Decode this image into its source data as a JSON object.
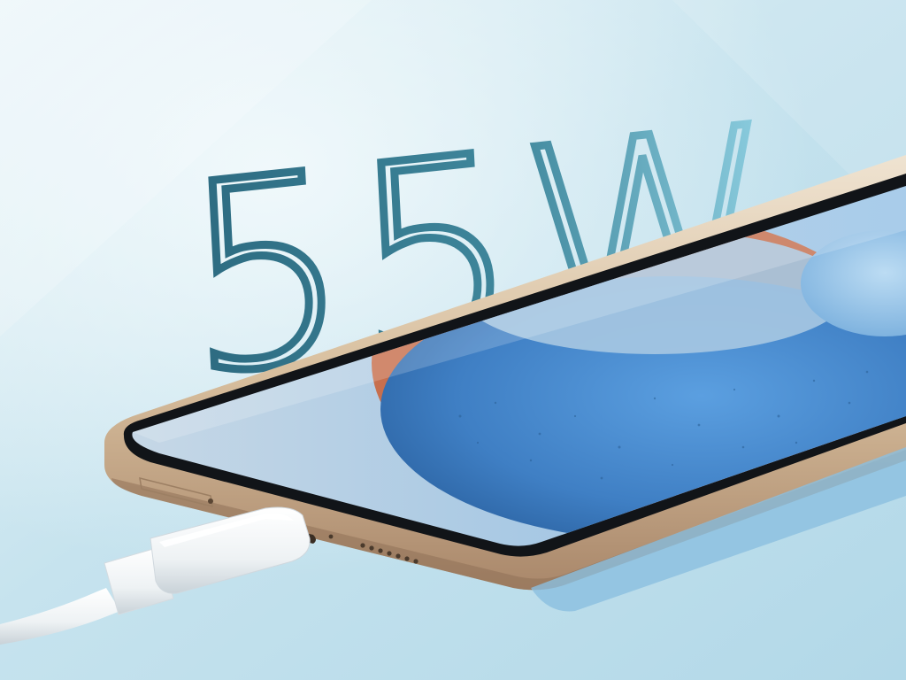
{
  "headline": {
    "text": "55W"
  },
  "colors": {
    "background_light": "#e6f3f7",
    "background_mid": "#b9dceb",
    "headline_dark": "#2f6f85",
    "headline_light": "#7fc6dc",
    "frame_gold": "#d9c2a3",
    "screen_blue": "#4d8ecf",
    "screen_orange": "#c9653d",
    "cable_white": "#f4f6f7"
  },
  "icons": [
    "usb-c-cable",
    "speaker-grille",
    "sim-tray"
  ]
}
